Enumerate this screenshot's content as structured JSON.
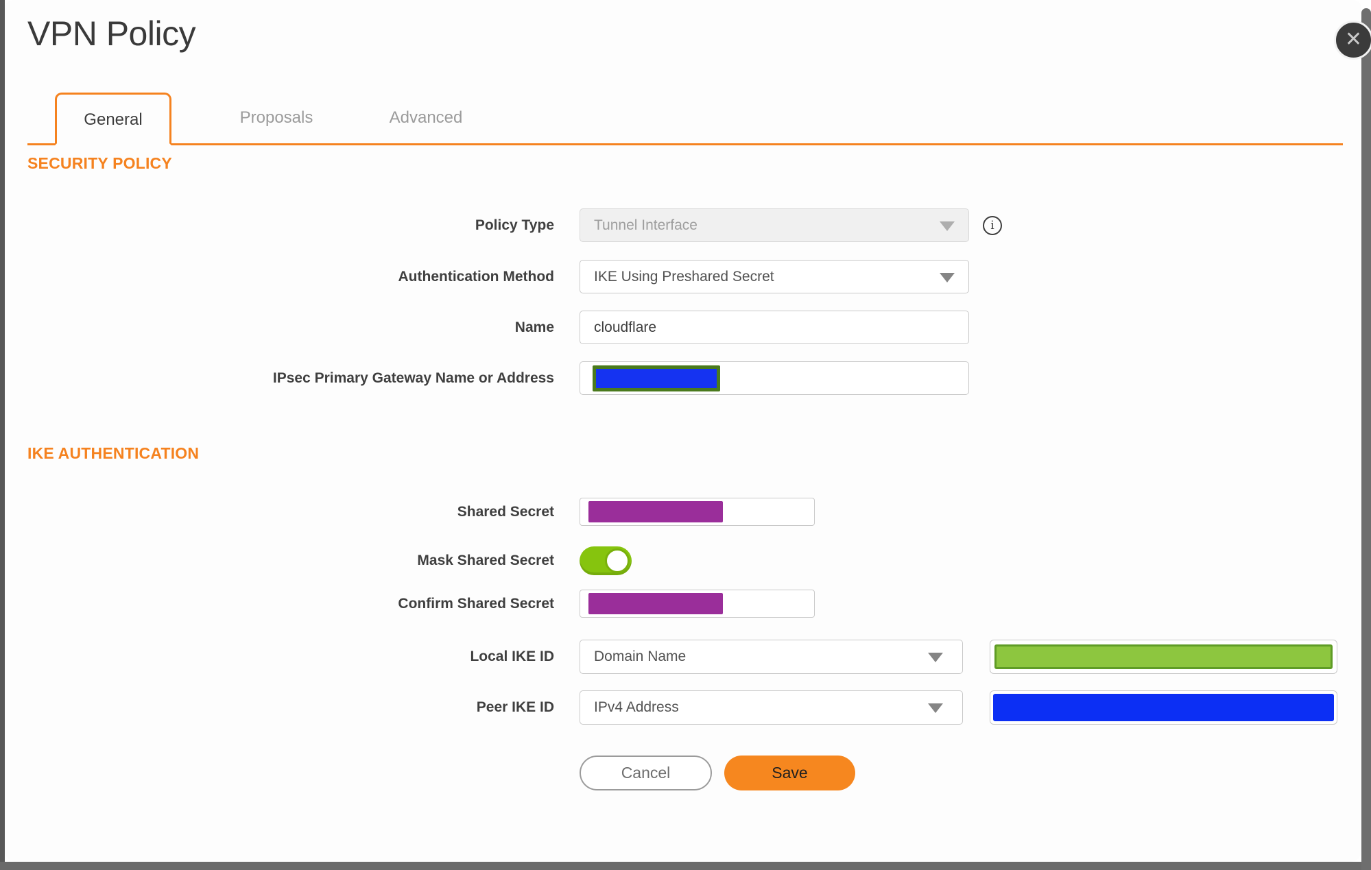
{
  "dialog": {
    "title": "VPN Policy",
    "close_icon": "✕",
    "info_icon": "i"
  },
  "tabs": [
    {
      "label": "General",
      "active": true
    },
    {
      "label": "Proposals",
      "active": false
    },
    {
      "label": "Advanced",
      "active": false
    }
  ],
  "sections": {
    "security_policy": "SECURITY POLICY",
    "ike_authentication": "IKE AUTHENTICATION"
  },
  "fields": {
    "policy_type": {
      "label": "Policy Type",
      "value": "Tunnel Interface",
      "disabled": true
    },
    "authentication_method": {
      "label": "Authentication Method",
      "value": "IKE Using Preshared Secret"
    },
    "name": {
      "label": "Name",
      "value": "cloudflare"
    },
    "gateway": {
      "label": "IPsec Primary Gateway Name or Address",
      "value_state": "redacted"
    },
    "shared_secret": {
      "label": "Shared Secret",
      "value_state": "redacted"
    },
    "mask_shared_secret": {
      "label": "Mask Shared Secret",
      "enabled": true
    },
    "confirm_shared_secret": {
      "label": "Confirm Shared Secret",
      "value_state": "redacted"
    },
    "local_ike_id": {
      "label": "Local IKE ID",
      "value": "Domain Name",
      "id_value_state": "redacted"
    },
    "peer_ike_id": {
      "label": "Peer IKE ID",
      "value": "IPv4 Address",
      "id_value_state": "redacted"
    }
  },
  "buttons": {
    "cancel": "Cancel",
    "save": "Save"
  },
  "colors": {
    "accent_orange": "#f5821f",
    "save_orange": "#f6871f",
    "toggle_green": "#86c40e",
    "redact_purple": "#9a2e9a",
    "redact_blue_gateway": "#1533f1",
    "redact_blue_peer": "#0c2ff4",
    "redact_green": "#8dc63f",
    "redact_green_border": "#5f9c26",
    "redact_olive_border": "#4a7a1d"
  }
}
